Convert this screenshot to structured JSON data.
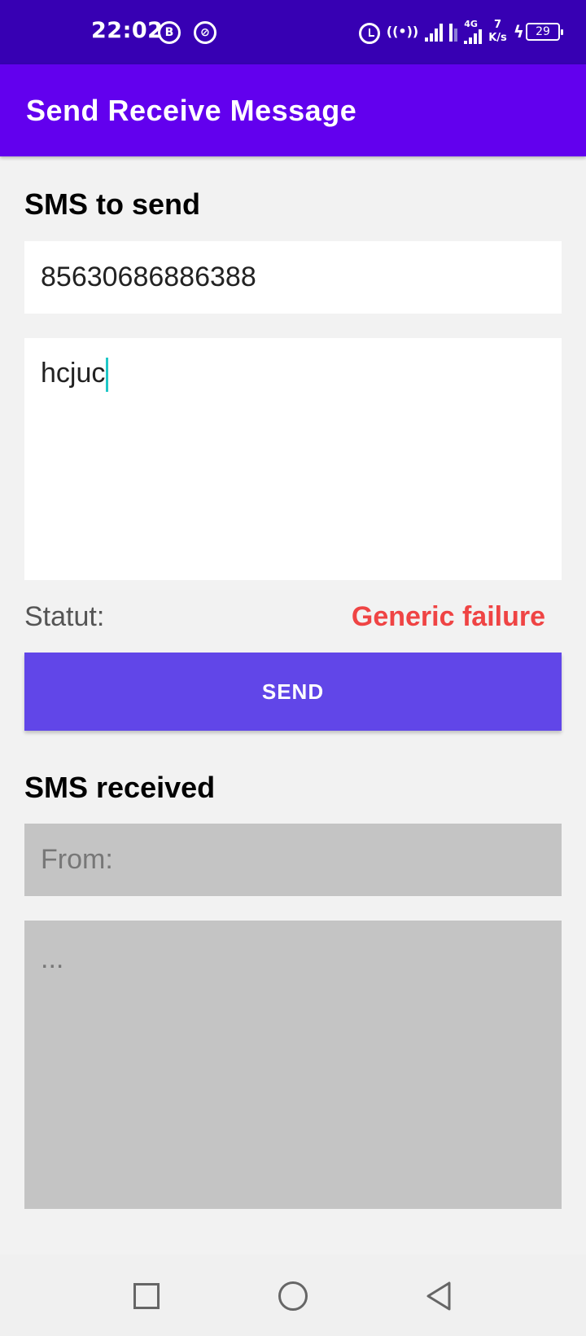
{
  "status_bar": {
    "time": "22:02",
    "notif_icon_1": "B",
    "network_4g": "4G",
    "speed_value": "7",
    "speed_unit": "K/s",
    "battery": "29"
  },
  "app_bar": {
    "title": "Send Receive Message"
  },
  "send_section": {
    "title": "SMS to send",
    "phone_value": "85630686886388",
    "message_value": "hcjuc",
    "status_label": "Statut:",
    "status_value": "Generic failure",
    "send_label": "SEND"
  },
  "receive_section": {
    "title": "SMS received",
    "from_placeholder": "From:",
    "message_placeholder": "..."
  },
  "colors": {
    "status_bar": "#3700b3",
    "app_bar": "#6200ee",
    "send_button": "#6146e8",
    "error": "#ef4444"
  }
}
